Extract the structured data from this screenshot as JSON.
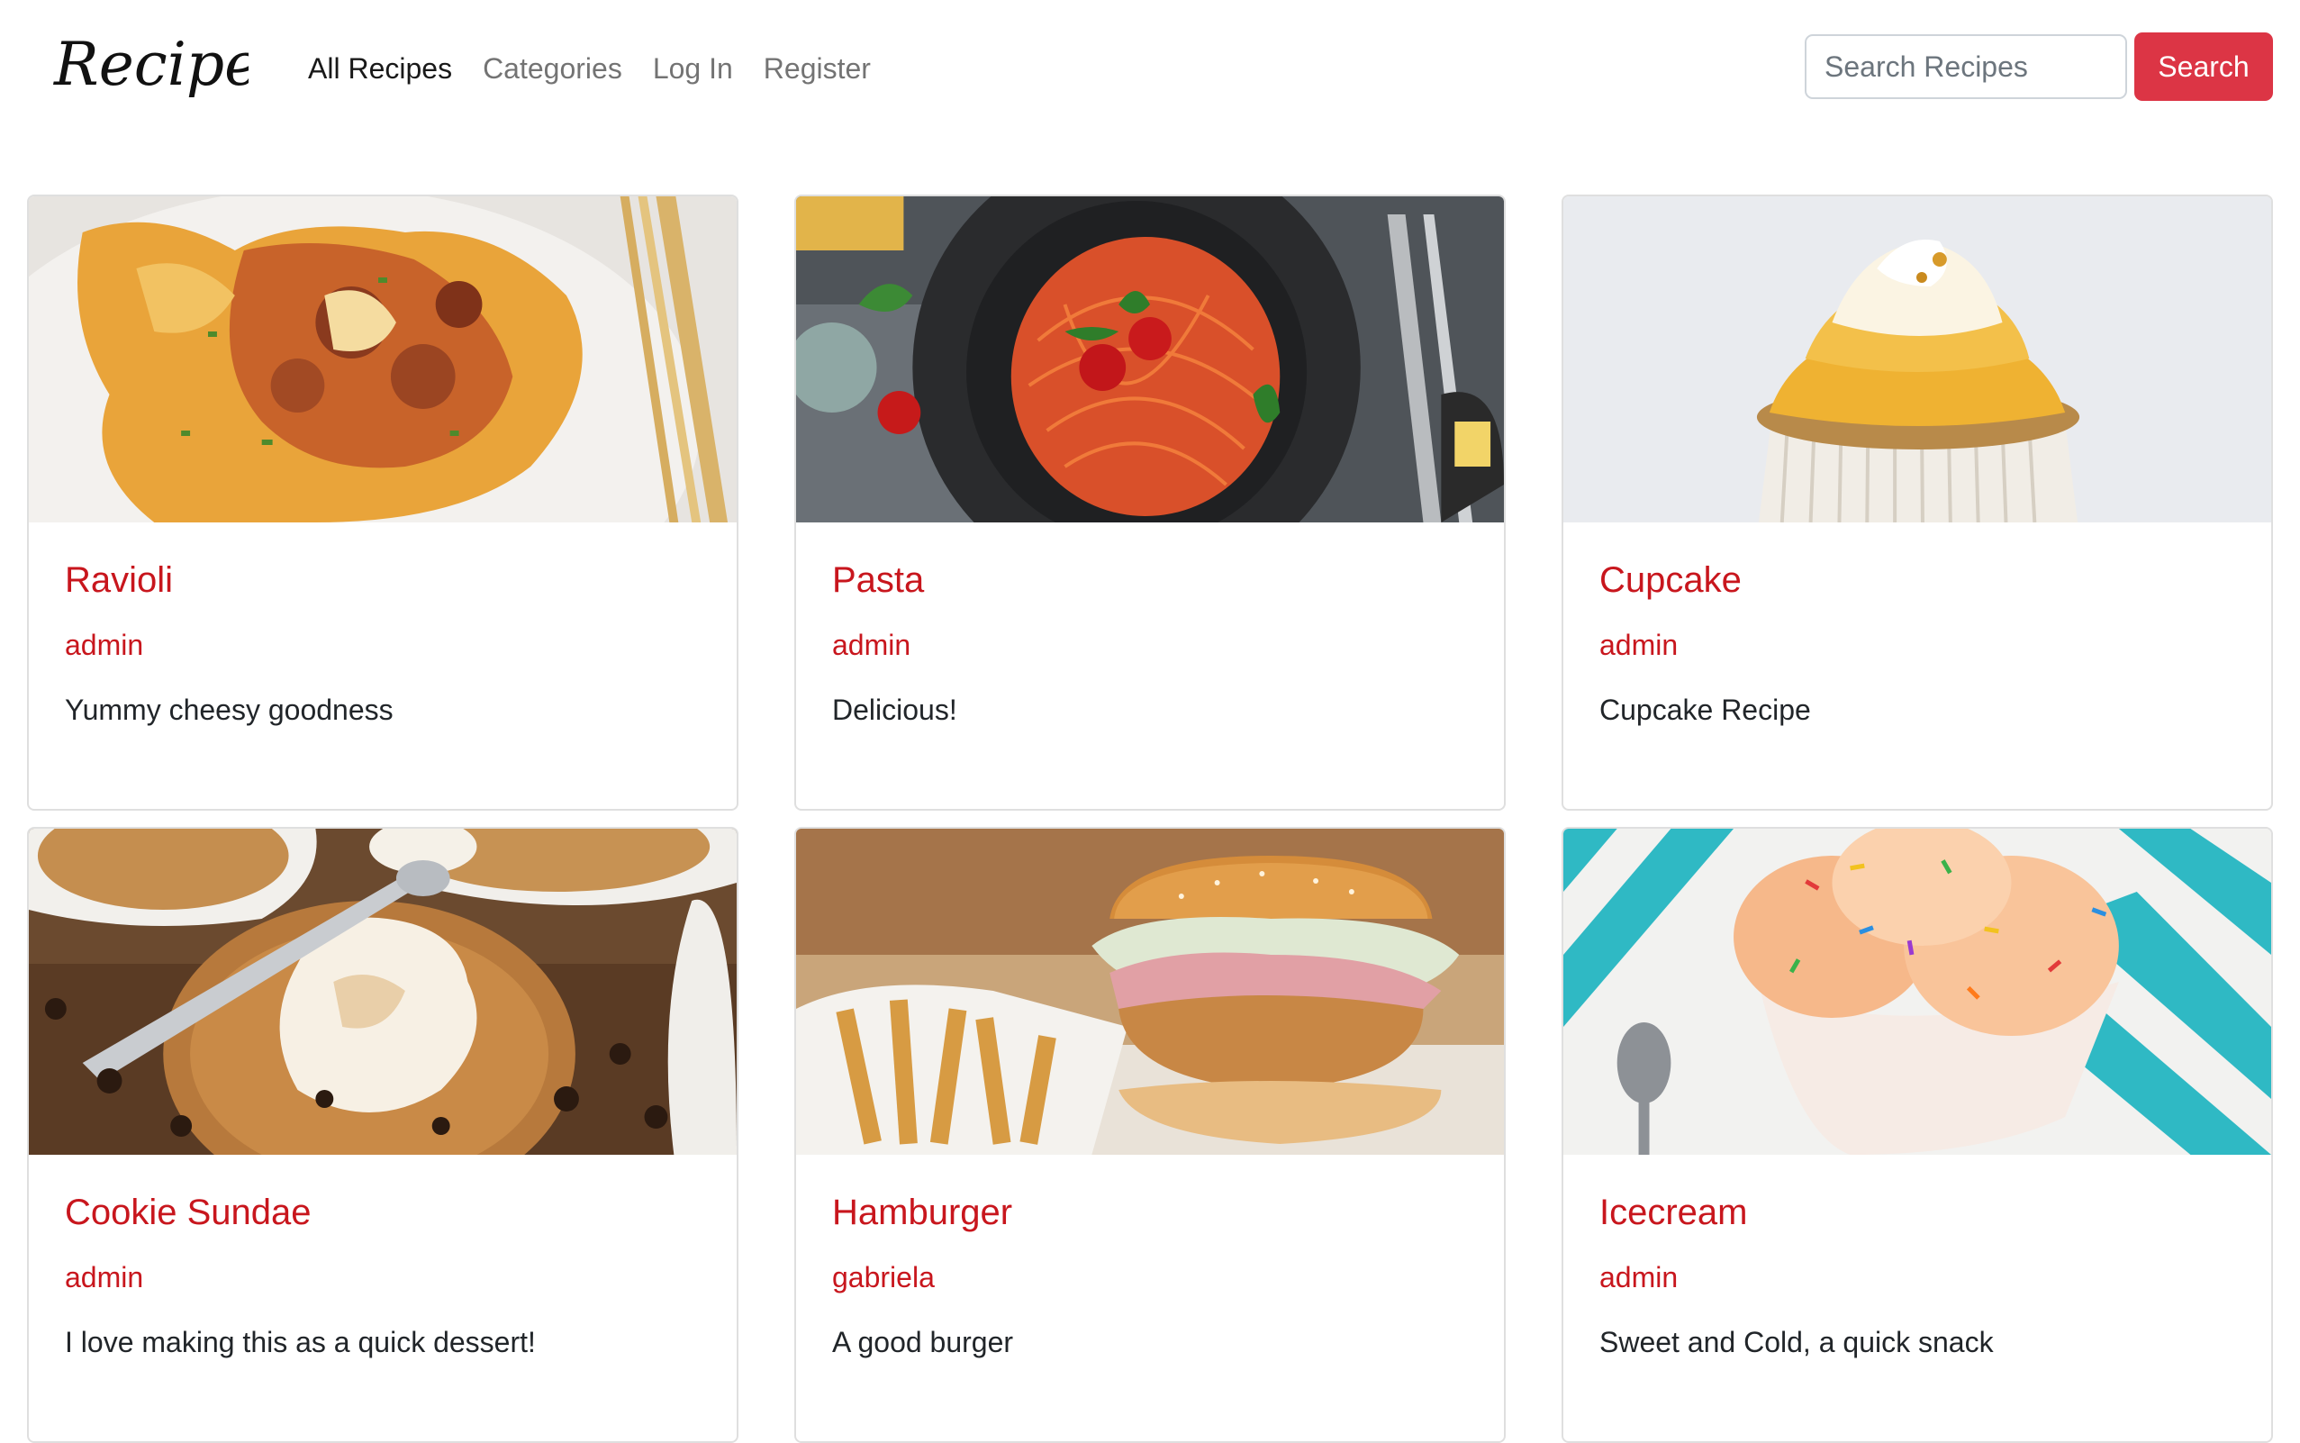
{
  "brand": {
    "logo_text": "Recipeas"
  },
  "nav": {
    "all_recipes": "All Recipes",
    "categories": "Categories",
    "log_in": "Log In",
    "register": "Register"
  },
  "search": {
    "placeholder": "Search Recipes",
    "button": "Search"
  },
  "colors": {
    "accent": "#dc3545",
    "title_red": "#c8161d"
  },
  "recipes": [
    {
      "title": "Ravioli",
      "author": "admin",
      "description": "Yummy cheesy goodness",
      "image": "ravioli-photo"
    },
    {
      "title": "Pasta",
      "author": "admin",
      "description": "Delicious!",
      "image": "pasta-photo"
    },
    {
      "title": "Cupcake",
      "author": "admin",
      "description": "Cupcake Recipe",
      "image": "cupcake-photo"
    },
    {
      "title": "Cookie Sundae",
      "author": "admin",
      "description": "I love making this as a quick dessert!",
      "image": "cookie-sundae-photo"
    },
    {
      "title": "Hamburger",
      "author": "gabriela",
      "description": "A good burger",
      "image": "hamburger-photo"
    },
    {
      "title": "Icecream",
      "author": "admin",
      "description": "Sweet and Cold, a quick snack",
      "image": "icecream-photo"
    }
  ]
}
